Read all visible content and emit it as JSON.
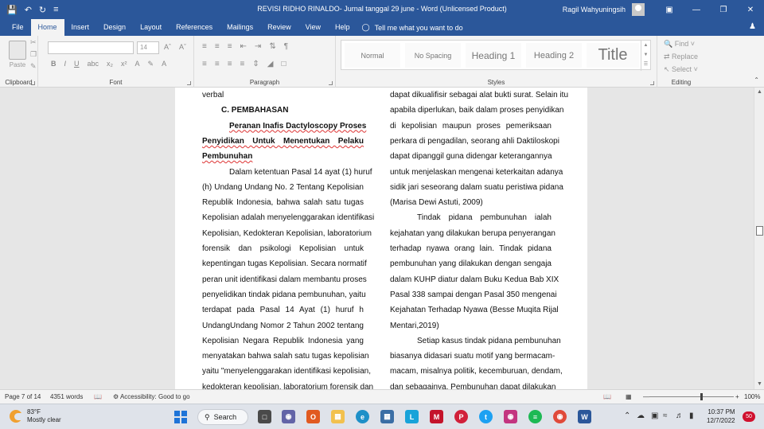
{
  "titlebar": {
    "title": "REVISI RIDHO RINALDO- Jurnal tanggal 29 june  -  Word (Unlicensed Product)",
    "user": "Ragil Wahyuningsih"
  },
  "tabs": [
    "File",
    "Home",
    "Insert",
    "Design",
    "Layout",
    "References",
    "Mailings",
    "Review",
    "View",
    "Help"
  ],
  "tell_me": "Tell me what you want to do",
  "ribbon": {
    "clipboard": {
      "label": "Clipboard",
      "paste": "Paste"
    },
    "font": {
      "label": "Font",
      "font_name": "",
      "font_size": "14"
    },
    "paragraph": {
      "label": "Paragraph"
    },
    "styles": {
      "label": "Styles",
      "items": [
        "Normal",
        "No Spacing",
        "Heading 1",
        "Heading 2",
        "Title"
      ]
    },
    "editing": {
      "label": "Editing",
      "find": "Find",
      "replace": "Replace",
      "select": "Select"
    }
  },
  "document": {
    "left_column": [
      {
        "text": "verbal",
        "style": "plain"
      },
      {
        "text": "C. PEMBAHASAN",
        "style": "heading"
      },
      {
        "text": "Peranan Inafis Dactyloscopy Proses",
        "style": "subheading"
      },
      {
        "text": "Penyidikan Untuk Menentukan Pelaku",
        "style": "subheading-just"
      },
      {
        "text": "Pembunuhan",
        "style": "subheading-left"
      },
      {
        "text": "Dalam ketentuan Pasal 14 ayat (1) huruf",
        "style": "indent"
      },
      {
        "text": "(h) Undang Undang No. 2 Tentang Kepolisian",
        "style": "just"
      },
      {
        "text": "Republik Indonesia, bahwa salah satu tugas",
        "style": "just"
      },
      {
        "text": "Kepolisian adalah menyelenggarakan identifikasi",
        "style": "just"
      },
      {
        "text": "Kepolisian, Kedokteran Kepolisian, laboratorium",
        "style": "just"
      },
      {
        "text": "forensik dan psikologi Kepolisian untuk",
        "style": "just"
      },
      {
        "text": "kepentingan tugas Kepolisian. Secara normatif",
        "style": "just"
      },
      {
        "text": "peran unit identifikasi dalam membantu proses",
        "style": "just"
      },
      {
        "text": "penyelidikan tindak pidana pembunuhan, yaitu",
        "style": "just"
      },
      {
        "text": "terdapat pada Pasal 14 Ayat (1) huruf h",
        "style": "just"
      },
      {
        "text": "UndangUndang Nomor 2 Tahun 2002 tentang",
        "style": "just"
      },
      {
        "text": "Kepolisian Negara Republik Indonesia yang",
        "style": "just"
      },
      {
        "text": "menyatakan bahwa salah satu tugas kepolisian",
        "style": "just"
      },
      {
        "text": "yaitu \"menyelenggarakan identifikasi kepolisian,",
        "style": "just"
      },
      {
        "text": "kedokteran kepolisian, laboratorium forensik dan",
        "style": "just"
      }
    ],
    "right_column": [
      {
        "text": "dapat dikualifisir sebagai alat bukti surat. Selain itu",
        "style": "plain"
      },
      {
        "text": "apabila diperlukan, baik dalam proses penyidikan",
        "style": "just"
      },
      {
        "text": "di kepolisian maupun proses pemeriksaan",
        "style": "just"
      },
      {
        "text": "perkara di pengadilan, seorang ahli Daktiloskopi",
        "style": "just"
      },
      {
        "text": "dapat dipanggil guna didengar keterangannya",
        "style": "just"
      },
      {
        "text": "untuk menjelaskan mengenai keterkaitan adanya",
        "style": "just"
      },
      {
        "text": "sidik jari seseorang dalam suatu peristiwa pidana",
        "style": "just"
      },
      {
        "text": "(Marisa Dewi Astuti, 2009)",
        "style": "plain"
      },
      {
        "text": "Tindak pidana pembunuhan ialah",
        "style": "indent-just"
      },
      {
        "text": "kejahatan yang dilakukan berupa penyerangan",
        "style": "just"
      },
      {
        "text": "terhadap nyawa orang lain. Tindak pidana",
        "style": "just"
      },
      {
        "text": "pembunuhan yang dilakukan dengan sengaja",
        "style": "just"
      },
      {
        "text": "dalam KUHP diatur dalam Buku Kedua Bab XIX",
        "style": "just"
      },
      {
        "text": "Pasal 338 sampai dengan Pasal 350 mengenai",
        "style": "just"
      },
      {
        "text": "Kejahatan Terhadap Nyawa (Besse Muqita Rijal",
        "style": "just"
      },
      {
        "text": "Mentari,2019)",
        "style": "plain"
      },
      {
        "text": "Setiap kasus tindak pidana pembunuhan",
        "style": "indent"
      },
      {
        "text": "biasanya didasari suatu motif yang bermacam-",
        "style": "just"
      },
      {
        "text": "macam, misalnya politik, kecemburuan, dendam,",
        "style": "just"
      },
      {
        "text": "dan sebagainya. Pembunuhan dapat dilakukan",
        "style": "just"
      }
    ]
  },
  "statusbar": {
    "page": "Page 7 of 14",
    "words": "4351 words",
    "accessibility": "Accessibility: Good to go",
    "zoom": "100%"
  },
  "taskbar": {
    "weather_temp": "83°F",
    "weather_desc": "Mostly clear",
    "search": "Search",
    "time": "10:37 PM",
    "date": "12/7/2022",
    "notifications": "50"
  },
  "colors": {
    "word_blue": "#2b579a",
    "squiggle": "#d33333"
  }
}
